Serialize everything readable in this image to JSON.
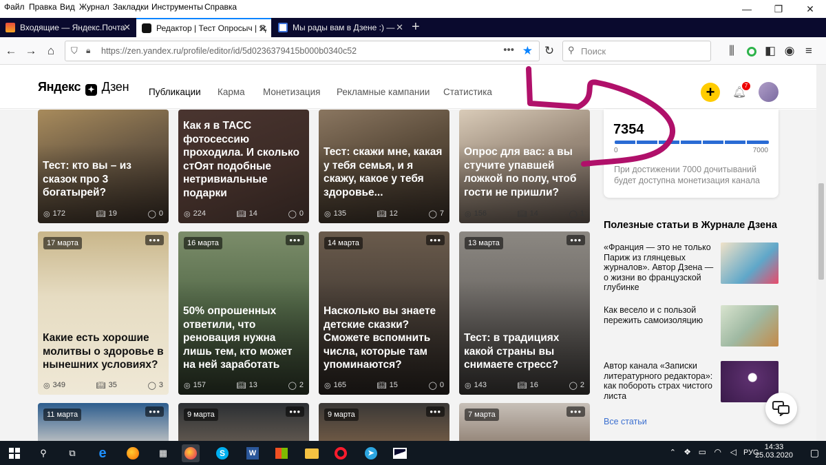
{
  "menubar": {
    "items": [
      "Файл",
      "Правка",
      "Вид",
      "Журнал",
      "Закладки",
      "Инструменты",
      "Справка"
    ]
  },
  "tabs": [
    {
      "title": "Входящие — Яндекс.Почта",
      "active": false,
      "icon": "mail-icon"
    },
    {
      "title": "Редактор | Тест Опросыч | Ядн",
      "active": true,
      "icon": "zen-icon"
    },
    {
      "title": "Мы рады вам в Дзене :) — Ya",
      "active": false,
      "icon": "doc-icon"
    }
  ],
  "navbar": {
    "url": "https://zen.yandex.ru/profile/editor/id/5d0236379415b000b0340c52",
    "search_placeholder": "Поиск"
  },
  "site": {
    "logo": "Яндекс",
    "logo_suffix": "Дзен",
    "nav": [
      "Публикации",
      "Карма",
      "Монетизация",
      "Рекламные кампании",
      "Статистика"
    ],
    "notifications": "7",
    "plus": "+"
  },
  "cards_row1": [
    {
      "title": "Тест: кто вы – из сказок про 3 богатырей?",
      "views": "172",
      "reads": "19",
      "comments": "0",
      "color": "#6b5a44"
    },
    {
      "title": "Как я в ТАСС фотосессию проходила. И сколько стОят подобные нетривиальные подарки",
      "views": "224",
      "reads": "14",
      "comments": "0",
      "color": "#3b2a25"
    },
    {
      "title": "Тест: скажи мне, какая у тебя семья, и я скажу, какое у тебя здоровье...",
      "views": "135",
      "reads": "12",
      "comments": "7",
      "color": "#5a4b3a"
    },
    {
      "title": "Опрос для вас: а вы стучите упавшей ложкой по полу, чтоб гости не пришли?",
      "views": "156",
      "reads": "14",
      "comments": "1",
      "color": "#9a8a7a"
    }
  ],
  "cards_row2": [
    {
      "date": "17 марта",
      "title": "Какие есть хорошие молитвы о здоровье в нынешних условиях?",
      "views": "349",
      "reads": "35",
      "comments": "3",
      "color": "#d8c9a6"
    },
    {
      "date": "16 марта",
      "title": "50% опрошенных ответили, что реновация нужна лишь тем, кто может на ней заработать",
      "views": "157",
      "reads": "13",
      "comments": "2",
      "color": "#556b4a"
    },
    {
      "date": "14 марта",
      "title": "Насколько вы знаете детские сказки? Сможете вспомнить числа, которые там упоминаются?",
      "views": "165",
      "reads": "15",
      "comments": "0",
      "color": "#4a4038"
    },
    {
      "date": "13 марта",
      "title": "Тест: в традициях какой страны вы снимаете стресс?",
      "views": "143",
      "reads": "16",
      "comments": "2",
      "color": "#6e6a66"
    }
  ],
  "cards_row3": [
    {
      "date": "11 марта",
      "color": "#2d5d8e"
    },
    {
      "date": "9 марта",
      "color": "#2b2f33"
    },
    {
      "date": "9 марта",
      "color": "#3a3836"
    },
    {
      "date": "7 марта",
      "color": "#c7c0b8"
    }
  ],
  "monetization": {
    "value": "7354",
    "min": "0",
    "max": "7000",
    "progress": 1.0,
    "note": "При достижении 7000 дочитываний будет доступна монетизация канала"
  },
  "articles": {
    "heading": "Полезные статьи в Журнале Дзена",
    "items": [
      {
        "text": "«Франция — это не только Париж из глянцевых журналов». Автор Дзена — о жизни во французской глубинке",
        "color": "#5fa7c9"
      },
      {
        "text": "Как весело и с пользой пережить самоизоляцию",
        "color": "#9fb9a2"
      },
      {
        "text": "Автор канала «Записки литературного редактора»: как побороть страх чистого листа",
        "color": "#5b2f6d"
      }
    ],
    "all_link": "Все статьи"
  },
  "taskbar": {
    "lang": "РУС",
    "time": "14:33",
    "date": "25.03.2020"
  },
  "colors": {
    "accent_yellow": "#ffcc00",
    "progress_blue": "#2a6bd4",
    "annotation_magenta": "#b0106a",
    "tabbar_bg": "#0a0a2e"
  }
}
